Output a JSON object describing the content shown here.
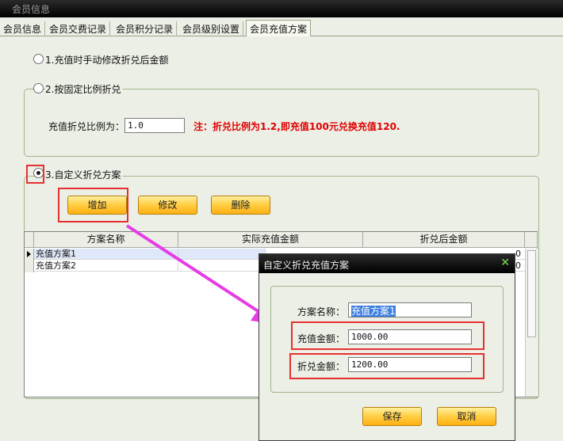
{
  "window": {
    "title": "会员信息"
  },
  "tabs": [
    "会员信息",
    "会员交费记录",
    "会员积分记录",
    "会员级别设置",
    "会员充值方案"
  ],
  "options": {
    "opt1_label": "1.充值时手动修改折兑后金额",
    "opt2_label": "2.按固定比例折兑",
    "ratio_label": "充值折兑比例为：",
    "ratio_value": "1.0",
    "ratio_note": "注：折兑比例为1.2,即充值100元兑换充值120.",
    "opt3_label": "3.自定义折兑方案"
  },
  "buttons": {
    "add": "增加",
    "edit": "修改",
    "delete": "删除"
  },
  "table": {
    "headers": [
      "方案名称",
      "实际充值金额",
      "折兑后金额"
    ],
    "rows": [
      {
        "name": "充值方案1",
        "partial": "0"
      },
      {
        "name": "充值方案2",
        "partial": "0"
      }
    ]
  },
  "dialog": {
    "title": "自定义折兑充值方案",
    "name_label": "方案名称：",
    "name_value": "充值方案1",
    "amount_label": "充值金额：",
    "amount_value": "1000.00",
    "converted_label": "折兑金额：",
    "converted_value": "1200.00",
    "save": "保存",
    "cancel": "取消"
  },
  "colors": {
    "annotation_box": "#e63030",
    "annotation_arrow": "#e63ce6",
    "accent_button": "#ffc22a",
    "note_text": "#e00000"
  }
}
